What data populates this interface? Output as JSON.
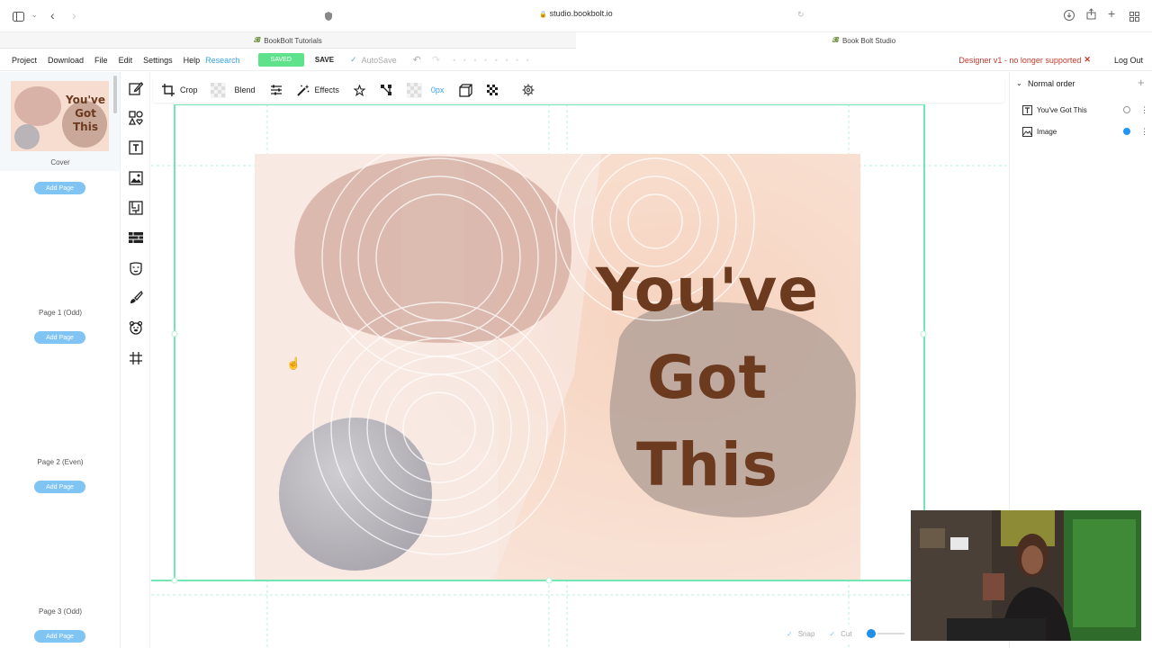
{
  "browser": {
    "url": "studio.bookbolt.io",
    "tabs": [
      {
        "label": "BookBolt Tutorials",
        "active": false
      },
      {
        "label": "Book Bolt Studio",
        "active": true
      }
    ]
  },
  "appbar": {
    "menu": [
      "Project",
      "Download",
      "File",
      "Edit",
      "Settings",
      "Help"
    ],
    "research": "Research",
    "saved_badge": "SAVED",
    "save_button": "SAVE",
    "autosave": "AutoSave",
    "notice": "Designer v1 - no longer supported",
    "logout": "Log Out"
  },
  "pages": {
    "cover_label": "Cover",
    "add_page": "Add Page",
    "thumb_text": [
      "You've",
      "Got",
      "This"
    ],
    "labels": [
      "Page 1 (Odd)",
      "Page 2 (Even)",
      "Page 3 (Odd)"
    ]
  },
  "toolbar": {
    "crop": "Crop",
    "blend": "Blend",
    "effects": "Effects",
    "border": "0px"
  },
  "canvas": {
    "text_lines": [
      "You've",
      "Got",
      "This"
    ]
  },
  "layers": {
    "order": "Normal order",
    "items": [
      {
        "name": "You've Got This",
        "type": "text",
        "visible": false
      },
      {
        "name": "Image",
        "type": "image",
        "visible": true
      }
    ]
  },
  "snapbar": {
    "snap": "Snap",
    "cut": "Cut"
  },
  "colors": {
    "accent": "#7fc4f2",
    "saved_green": "#5ee38c",
    "notice_red": "#c0392b",
    "title_brown": "#6b3a1f",
    "guide_green": "#73e6b6"
  }
}
